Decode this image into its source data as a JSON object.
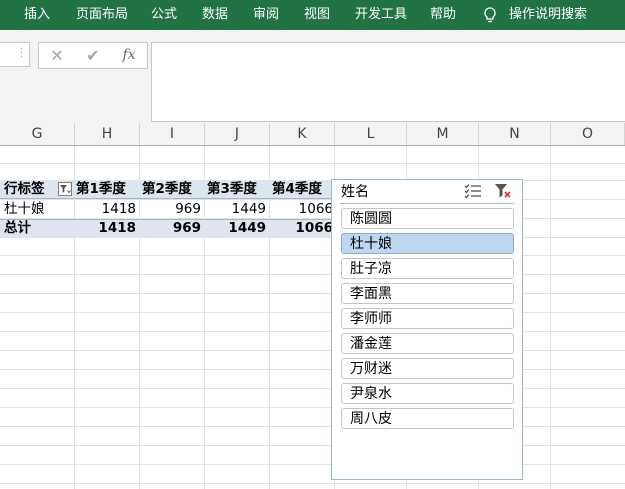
{
  "ribbon": {
    "tabs": [
      "插入",
      "页面布局",
      "公式",
      "数据",
      "审阅",
      "视图",
      "开发工具",
      "帮助"
    ],
    "search_label": "操作说明搜索"
  },
  "formula_bar": {
    "cancel_glyph": "✕",
    "enter_glyph": "✔",
    "fx_label": "fx",
    "value": ""
  },
  "columns": [
    "G",
    "H",
    "I",
    "J",
    "K",
    "L",
    "M",
    "N",
    "O"
  ],
  "pivot": {
    "row_label_header": "行标签",
    "quarter_headers": [
      "第1季度",
      "第2季度",
      "第3季度",
      "第4季度"
    ],
    "rows": [
      {
        "name": "杜十娘",
        "values": [
          "1418",
          "969",
          "1449",
          "1066"
        ]
      }
    ],
    "total": {
      "name": "总计",
      "values": [
        "1418",
        "969",
        "1449",
        "1066"
      ]
    }
  },
  "slicer": {
    "title": "姓名",
    "items": [
      {
        "label": "陈圆圆",
        "selected": false
      },
      {
        "label": "杜十娘",
        "selected": true
      },
      {
        "label": "肚子凉",
        "selected": false
      },
      {
        "label": "李面黑",
        "selected": false
      },
      {
        "label": "李师师",
        "selected": false
      },
      {
        "label": "潘金莲",
        "selected": false
      },
      {
        "label": "万财迷",
        "selected": false
      },
      {
        "label": "尹泉水",
        "selected": false
      },
      {
        "label": "周八皮",
        "selected": false
      }
    ]
  },
  "colors": {
    "ribbon": "#217346",
    "pivot_header_fill": "#dce6f1",
    "slicer_selected": "#bdd7ee",
    "slicer_border": "#9bb8d3"
  }
}
